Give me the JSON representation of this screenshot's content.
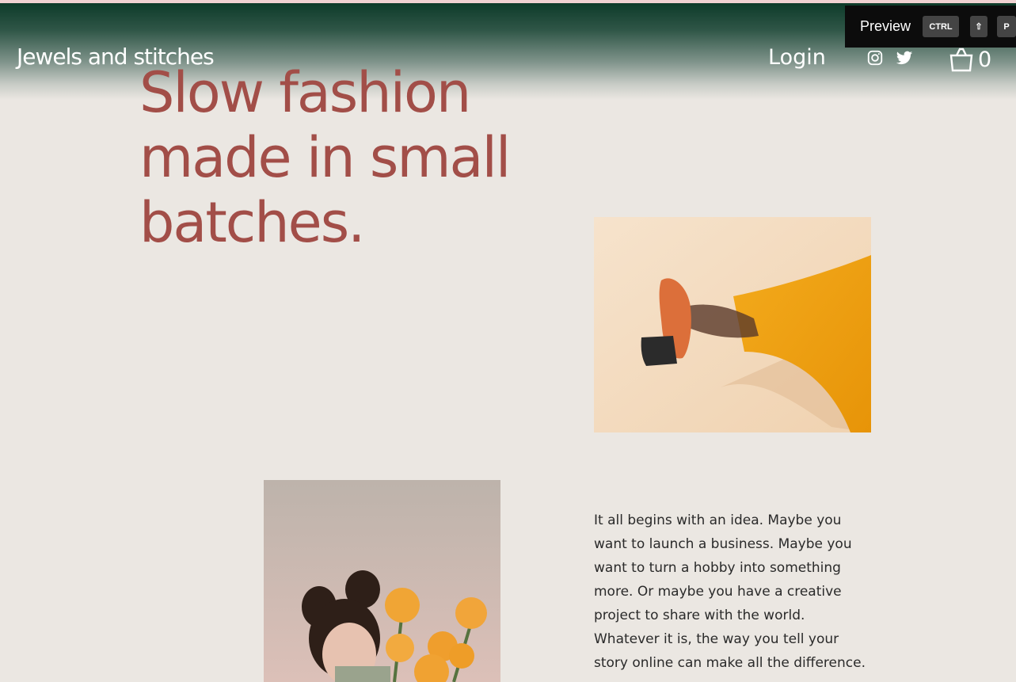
{
  "header": {
    "site_title": "Jewels and stitches",
    "login_label": "Login",
    "cart_count": "0",
    "social": [
      "instagram-icon",
      "twitter-icon"
    ]
  },
  "preview_bar": {
    "label": "Preview",
    "keys": [
      "CTRL",
      "⇧",
      "P"
    ]
  },
  "hero": {
    "heading": "Slow fashion made in small batches."
  },
  "images": {
    "shoe_photo": "orange heel and mustard skirt",
    "woman_photo": "woman holding orange flowers"
  },
  "content": {
    "body": "It all begins with an idea. Maybe you want to launch a business. Maybe you want to turn a hobby into something more. Or maybe you have a creative project to share with the world. Whatever it is, the way you tell your story online can make all the difference."
  },
  "colors": {
    "background": "#ebe7e2",
    "header_dark": "#0e3b2a",
    "heading": "#a24e48",
    "body_text": "#2a2a2a"
  }
}
